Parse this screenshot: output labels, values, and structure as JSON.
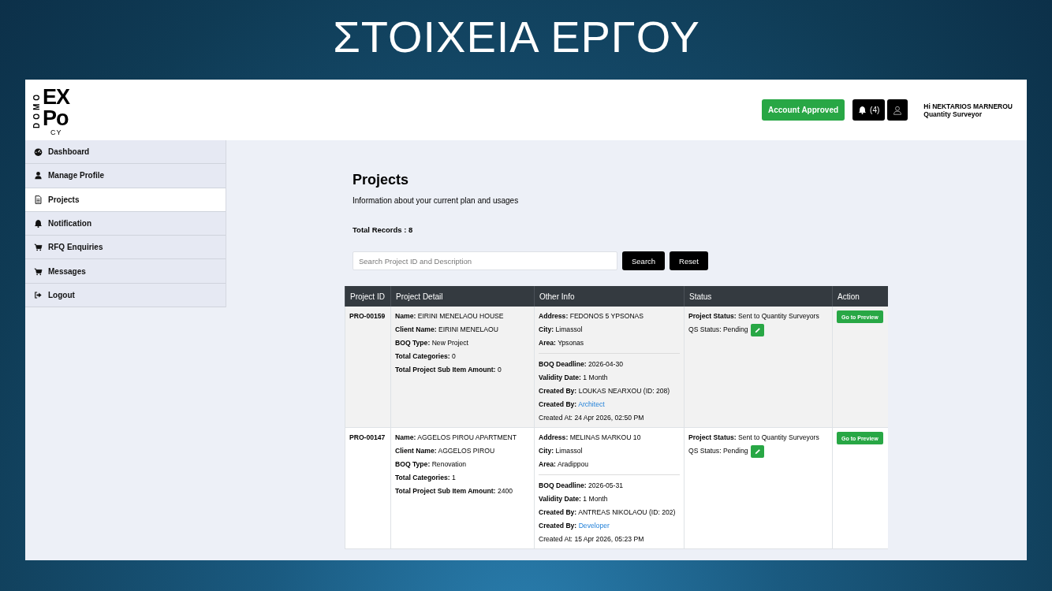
{
  "slide_title": "ΣΤΟΙΧΕΙΑ ΕΡΓΟΥ",
  "logo": {
    "side": "DOMO",
    "top": "EX",
    "middle": "Po",
    "bottom": "CY"
  },
  "header": {
    "account_status": "Account Approved",
    "notifications": "(4)",
    "greeting": "Hi NEKTARIOS MARNEROU",
    "role": "Quantity Surveyor"
  },
  "sidebar": {
    "items": [
      {
        "label": "Dashboard",
        "selected": false
      },
      {
        "label": "Manage Profile",
        "selected": false
      },
      {
        "label": "Projects",
        "selected": true
      },
      {
        "label": "Notification",
        "selected": false
      },
      {
        "label": "RFQ Enquiries",
        "selected": false
      },
      {
        "label": "Messages",
        "selected": false
      },
      {
        "label": "Logout",
        "selected": false
      }
    ]
  },
  "page": {
    "title": "Projects",
    "subtitle": "Information about your current plan and usages",
    "total_records": "Total Records : 8"
  },
  "search": {
    "placeholder": "Search Project ID and Description",
    "buttons": [
      "Search",
      "Reset"
    ]
  },
  "table": {
    "columns": [
      "Project ID",
      "Project Detail",
      "Other Info",
      "Status",
      "Action"
    ],
    "rows": [
      {
        "id": "PRO-00159",
        "detail": [
          {
            "label": "Name:",
            "value": "EIRINI MENELAOU HOUSE"
          },
          {
            "label": "Client Name:",
            "value": "EIRINI MENELAOU"
          },
          {
            "label": "BOQ Type:",
            "value": "New Project"
          },
          {
            "label": "Total Categories:",
            "value": "0"
          },
          {
            "label": "Total Project Sub Item Amount:",
            "value": "0"
          }
        ],
        "location": [
          {
            "label": "Address:",
            "value": "FEDONOS 5 YPSONAS"
          },
          {
            "label": "City:",
            "value": "Limassol"
          },
          {
            "label": "Area:",
            "value": "Ypsonas"
          }
        ],
        "deadline_info": [
          {
            "kind": "field",
            "label": "BOQ Deadline:",
            "value": "2026-04-30"
          },
          {
            "kind": "field",
            "label": "Validity Date:",
            "value": "1 Month"
          },
          {
            "kind": "field",
            "label": "Created By:",
            "value": "LOUKAS NEARXOU (ID: 208)"
          },
          {
            "kind": "link",
            "label": "Created By:",
            "value": "Architect"
          },
          {
            "kind": "note",
            "value": "Created At: 24 Apr 2026, 02:50 PM"
          }
        ],
        "project_status": {
          "label": "Project Status:",
          "value": "Sent to Quantity Surveyors"
        },
        "qs_status": "QS Status: Pending",
        "action": "Go to Preview"
      },
      {
        "id": "PRO-00147",
        "detail": [
          {
            "label": "Name:",
            "value": "AGGELOS PIROU APARTMENT"
          },
          {
            "label": "Client Name:",
            "value": "AGGELOS PIROU"
          },
          {
            "label": "BOQ Type:",
            "value": "Renovation"
          },
          {
            "label": "Total Categories:",
            "value": "1"
          },
          {
            "label": "Total Project Sub Item Amount:",
            "value": "2400"
          }
        ],
        "location": [
          {
            "label": "Address:",
            "value": "MELINAS MARKOU 10"
          },
          {
            "label": "City:",
            "value": "Limassol"
          },
          {
            "label": "Area:",
            "value": "Aradippou"
          }
        ],
        "deadline_info": [
          {
            "kind": "field",
            "label": "BOQ Deadline:",
            "value": "2026-05-31"
          },
          {
            "kind": "field",
            "label": "Validity Date:",
            "value": "1 Month"
          },
          {
            "kind": "field",
            "label": "Created By:",
            "value": "ANTREAS NIKOLAOU (ID: 202)"
          },
          {
            "kind": "link",
            "label": "Created By:",
            "value": "Developer"
          },
          {
            "kind": "note",
            "value": "Created At: 15 Apr 2026, 05:23 PM"
          }
        ],
        "project_status": {
          "label": "Project Status:",
          "value": "Sent to Quantity Surveyors"
        },
        "qs_status": "QS Status: Pending",
        "action": "Go to Preview"
      }
    ]
  }
}
